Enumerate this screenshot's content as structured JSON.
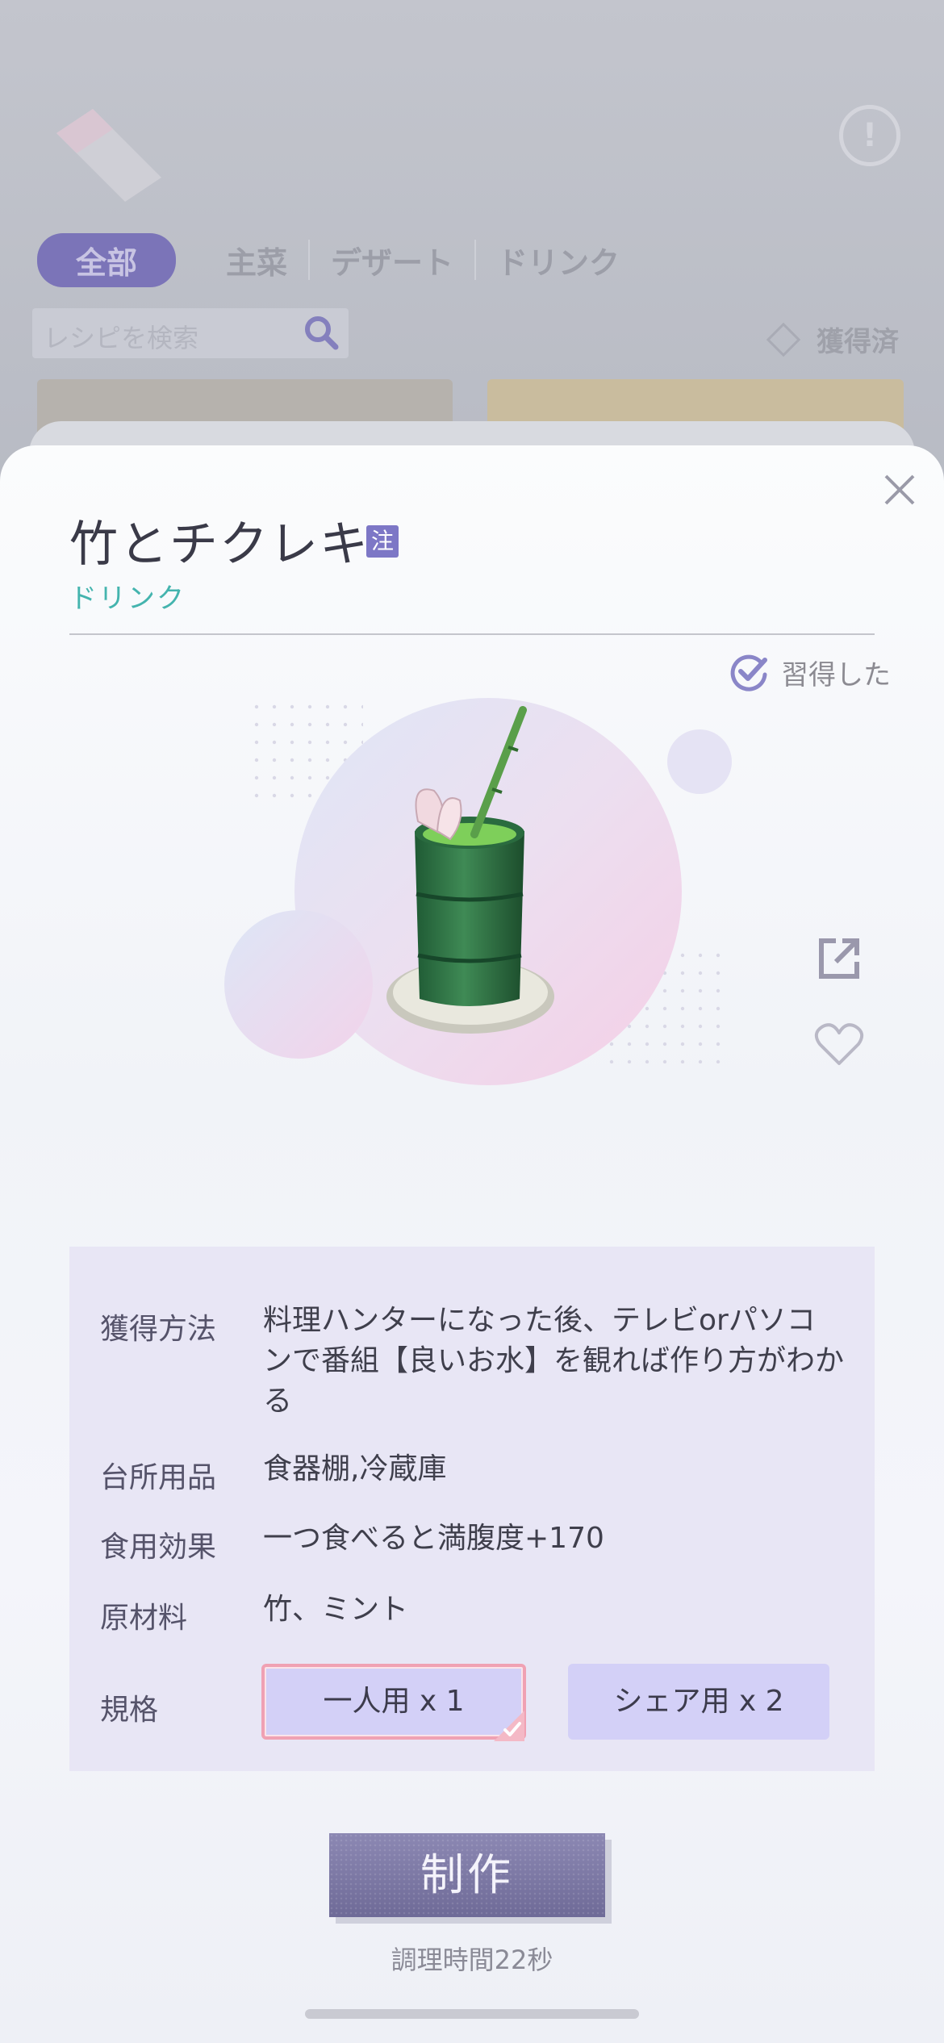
{
  "background": {
    "tabs": [
      "全部",
      "主菜",
      "デザート",
      "ドリンク"
    ],
    "search_placeholder": "レシピを検索",
    "owned_filter": "獲得済",
    "info_glyph": "!"
  },
  "recipe": {
    "title": "竹とチクレキ",
    "note_badge": "注",
    "category": "ドリンク",
    "learned_label": "習得した"
  },
  "details": {
    "acquire": {
      "label": "獲得方法",
      "value": "料理ハンターになった後、テレビorパソコンで番組【良いお水】を観れば作り方がわかる"
    },
    "utensils": {
      "label": "台所用品",
      "value": "食器棚,冷蔵庫"
    },
    "effect": {
      "label": "食用効果",
      "value": "一つ食べると満腹度+170"
    },
    "ingredients": {
      "label": "原材料",
      "value": "竹、ミント"
    },
    "spec": {
      "label": "規格",
      "options": [
        "一人用 x 1",
        "シェア用 x 2"
      ],
      "selected": "一人用 x 1"
    }
  },
  "actions": {
    "make_label": "制作",
    "cook_time": "調理時間22秒"
  },
  "icons": [
    "close-icon",
    "check-circle-icon",
    "share-icon",
    "heart-icon",
    "search-icon",
    "checkmark-icon"
  ],
  "colors": {
    "accent": "#7d77c6",
    "category": "#44b4ae",
    "panel": "#e8e6f5",
    "selected_border": "#f0a1b3"
  }
}
